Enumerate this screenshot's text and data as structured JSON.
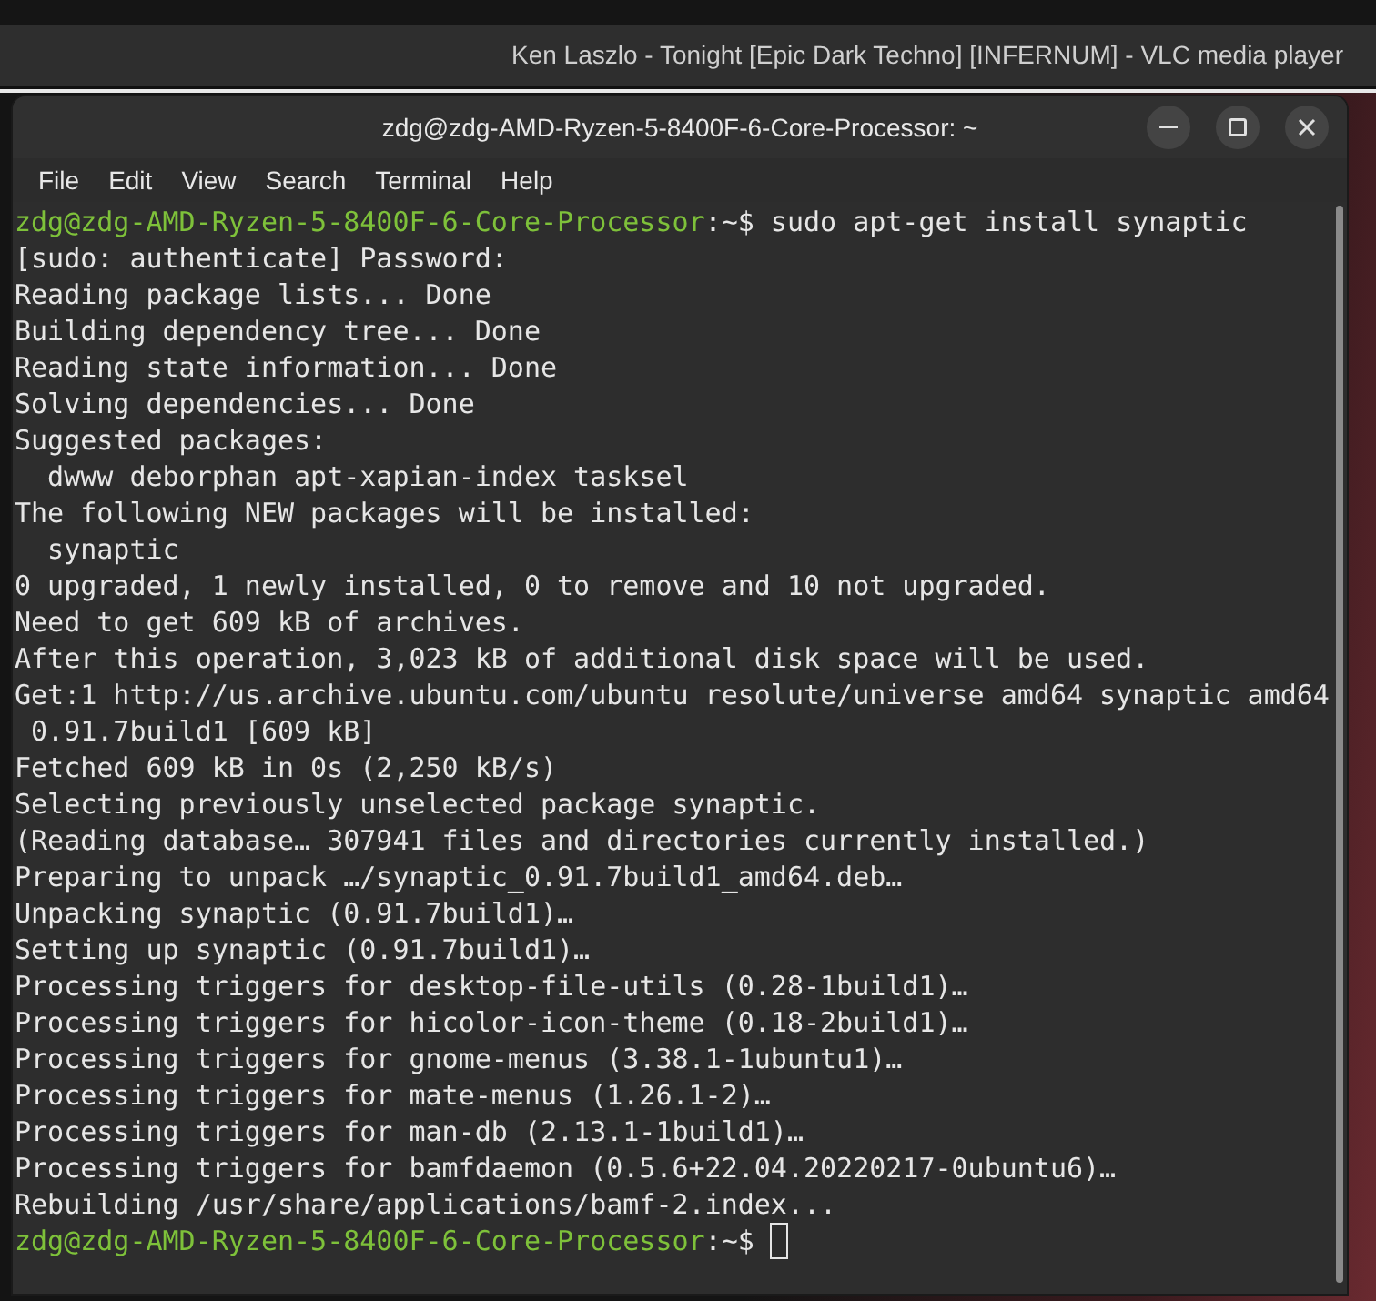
{
  "player_window": {
    "title": "Ken Laszlo - Tonight [Epic Dark Techno] [INFERNUM] - VLC media player"
  },
  "terminal": {
    "title": "zdg@zdg-AMD-Ryzen-5-8400F-6-Core-Processor: ~",
    "menu": [
      "File",
      "Edit",
      "View",
      "Search",
      "Terminal",
      "Help"
    ],
    "lines": [
      {
        "kind": "prompt",
        "user_host": "zdg@zdg-AMD-Ryzen-5-8400F-6-Core-Processor",
        "path": ":~$",
        "command": " sudo apt-get install synaptic"
      },
      {
        "kind": "output",
        "text": "[sudo: authenticate] Password:"
      },
      {
        "kind": "output",
        "text": "Reading package lists... Done"
      },
      {
        "kind": "output",
        "text": "Building dependency tree... Done"
      },
      {
        "kind": "output",
        "text": "Reading state information... Done"
      },
      {
        "kind": "output",
        "text": "Solving dependencies... Done"
      },
      {
        "kind": "output",
        "text": "Suggested packages:"
      },
      {
        "kind": "output",
        "text": "  dwww deborphan apt-xapian-index tasksel"
      },
      {
        "kind": "output",
        "text": "The following NEW packages will be installed:"
      },
      {
        "kind": "output",
        "text": "  synaptic"
      },
      {
        "kind": "output",
        "text": "0 upgraded, 1 newly installed, 0 to remove and 10 not upgraded."
      },
      {
        "kind": "output",
        "text": "Need to get 609 kB of archives."
      },
      {
        "kind": "output",
        "text": "After this operation, 3,023 kB of additional disk space will be used."
      },
      {
        "kind": "output",
        "text": "Get:1 http://us.archive.ubuntu.com/ubuntu resolute/universe amd64 synaptic amd64"
      },
      {
        "kind": "output",
        "text": " 0.91.7build1 [609 kB]"
      },
      {
        "kind": "output",
        "text": "Fetched 609 kB in 0s (2,250 kB/s)"
      },
      {
        "kind": "output",
        "text": "Selecting previously unselected package synaptic."
      },
      {
        "kind": "output",
        "text": "(Reading database… 307941 files and directories currently installed.)"
      },
      {
        "kind": "output",
        "text": "Preparing to unpack …/synaptic_0.91.7build1_amd64.deb…"
      },
      {
        "kind": "output",
        "text": "Unpacking synaptic (0.91.7build1)…"
      },
      {
        "kind": "output",
        "text": "Setting up synaptic (0.91.7build1)…"
      },
      {
        "kind": "output",
        "text": "Processing triggers for desktop-file-utils (0.28-1build1)…"
      },
      {
        "kind": "output",
        "text": "Processing triggers for hicolor-icon-theme (0.18-2build1)…"
      },
      {
        "kind": "output",
        "text": "Processing triggers for gnome-menus (3.38.1-1ubuntu1)…"
      },
      {
        "kind": "output",
        "text": "Processing triggers for mate-menus (1.26.1-2)…"
      },
      {
        "kind": "output",
        "text": "Processing triggers for man-db (2.13.1-1build1)…"
      },
      {
        "kind": "output",
        "text": "Processing triggers for bamfdaemon (0.5.6+22.04.20220217-0ubuntu6)…"
      },
      {
        "kind": "output",
        "text": "Rebuilding /usr/share/applications/bamf-2.index..."
      },
      {
        "kind": "prompt",
        "user_host": "zdg@zdg-AMD-Ryzen-5-8400F-6-Core-Processor",
        "path": ":~$",
        "cursor": true
      }
    ]
  }
}
